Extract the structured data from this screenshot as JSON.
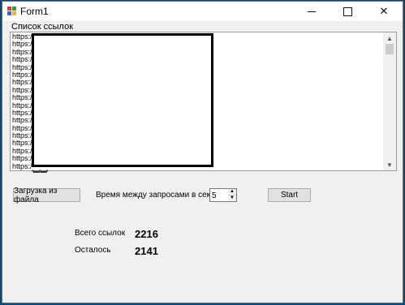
{
  "window": {
    "title": "Form1",
    "minimize_glyph": "—",
    "maximize_glyph": "□",
    "close_glyph": "✕",
    "icon": "winforms-app-icon",
    "icon_colors": [
      "#e03a2f",
      "#3a9a3a",
      "#2f6fd0",
      "#f2b51b"
    ]
  },
  "links": {
    "label": "Список ссылок",
    "items": [
      "https:/",
      "https:/",
      "https:/",
      "https:/",
      "https:/",
      "https:/",
      "https:/",
      "https:/",
      "https:/",
      "https:/",
      "https:/",
      "https:/",
      "https:/",
      "https:/",
      "https:/",
      "https:/",
      "https:/",
      "https:/"
    ],
    "scroll_up_glyph": "▲",
    "scroll_down_glyph": "▼"
  },
  "controls": {
    "load_button": "Загрузка из файла",
    "delay_label": "Время между запросами в секундах",
    "delay_value": "5",
    "spin_up_glyph": "▲",
    "spin_down_glyph": "▼",
    "start_button": "Start"
  },
  "stats": {
    "total_label": "Всего ссылок",
    "total_value": "2216",
    "remaining_label": "Осталось",
    "remaining_value": "2141"
  },
  "overlay": {
    "ghost_text": "▪▬▪▬▪"
  }
}
